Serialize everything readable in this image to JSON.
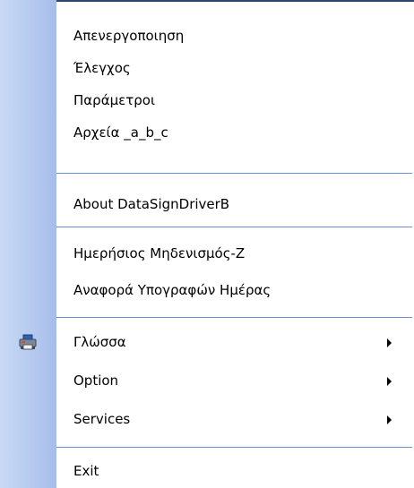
{
  "menu": {
    "items": [
      {
        "label": "Απενεργοποιηση",
        "has_submenu": false
      },
      {
        "label": "Έλεγχος",
        "has_submenu": false
      },
      {
        "label": "Παράμετροι",
        "has_submenu": false
      },
      {
        "label": "Αρχεία _a_b_c",
        "has_submenu": false
      },
      {
        "label": "About DataSignDriverB",
        "has_submenu": false
      },
      {
        "label": "Ημερήσιος Μηδενισμός-Ζ",
        "has_submenu": false
      },
      {
        "label": "Αναφορά Υπογραφών Ημέρας",
        "has_submenu": false
      },
      {
        "label": "Γλώσσα",
        "has_submenu": true,
        "icon": "printer-icon"
      },
      {
        "label": "Option",
        "has_submenu": true
      },
      {
        "label": "Services",
        "has_submenu": true
      },
      {
        "label": "Exit",
        "has_submenu": false
      }
    ]
  },
  "colors": {
    "gutter_light": "#c9d9f5",
    "gutter_dark": "#a6bde9",
    "separator": "#6b8ed6",
    "border": "#27476f",
    "text": "#000000"
  }
}
